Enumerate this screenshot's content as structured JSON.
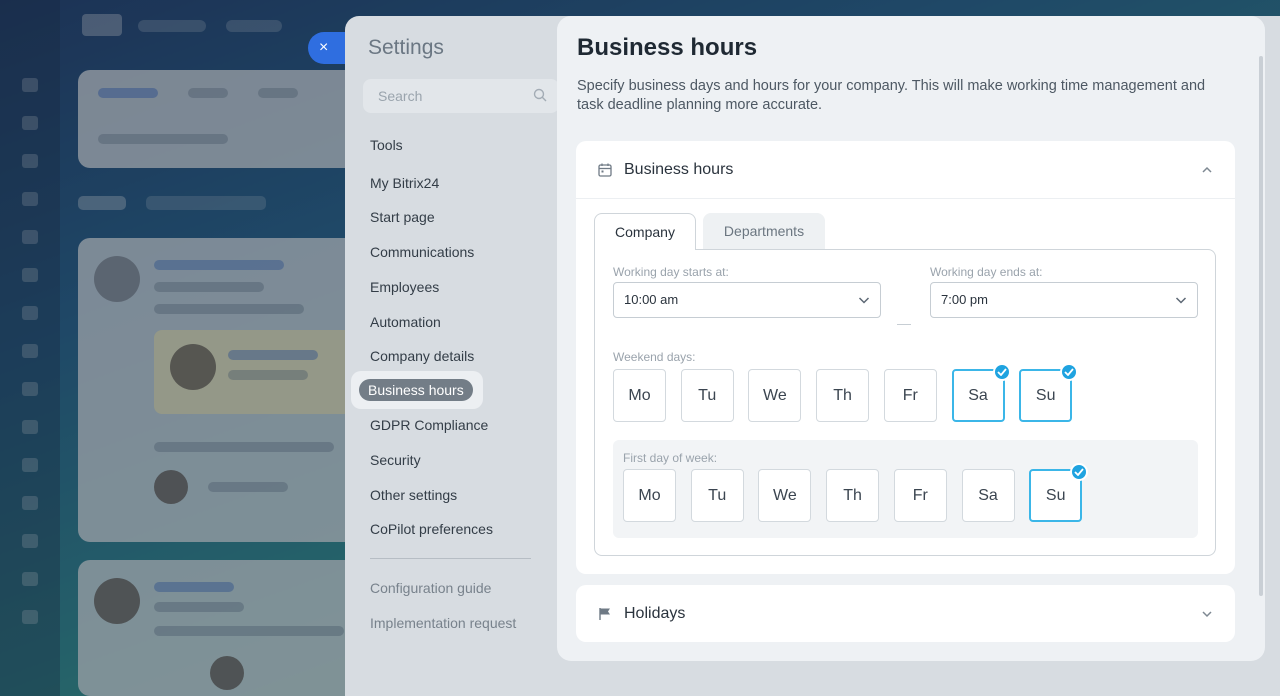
{
  "background": {
    "accent": "#2f6ee0"
  },
  "close_button": {
    "icon": "close-icon",
    "label": "×"
  },
  "settings": {
    "title": "Settings",
    "search": {
      "placeholder": "Search",
      "value": ""
    },
    "nav": [
      "Tools",
      "My Bitrix24",
      "Start page",
      "Communications",
      "Employees",
      "Automation",
      "Company details",
      "Business hours",
      "GDPR Compliance",
      "Security",
      "Other settings",
      "CoPilot preferences"
    ],
    "nav_secondary": [
      "Configuration guide",
      "Implementation request"
    ],
    "active_item": "Business hours"
  },
  "page": {
    "title": "Business hours",
    "description": "Specify business days and hours for your company. This will make working time management and task deadline planning more accurate."
  },
  "business_hours_card": {
    "title": "Business hours",
    "icon": "calendar-icon",
    "expanded": true,
    "tabs": [
      "Company",
      "Departments"
    ],
    "active_tab": "Company",
    "start": {
      "label": "Working day starts at:",
      "value": "10:00 am"
    },
    "end": {
      "label": "Working day ends at:",
      "value": "7:00 pm"
    },
    "weekend": {
      "label": "Weekend days:",
      "days": [
        "Mo",
        "Tu",
        "We",
        "Th",
        "Fr",
        "Sa",
        "Su"
      ],
      "selected": [
        "Sa",
        "Su"
      ]
    },
    "first_day": {
      "label": "First day of week:",
      "days": [
        "Mo",
        "Tu",
        "We",
        "Th",
        "Fr",
        "Sa",
        "Su"
      ],
      "selected": [
        "Su"
      ]
    },
    "selected_color": "#3bb6e8"
  },
  "holidays_card": {
    "title": "Holidays",
    "icon": "flag-icon",
    "expanded": false
  }
}
